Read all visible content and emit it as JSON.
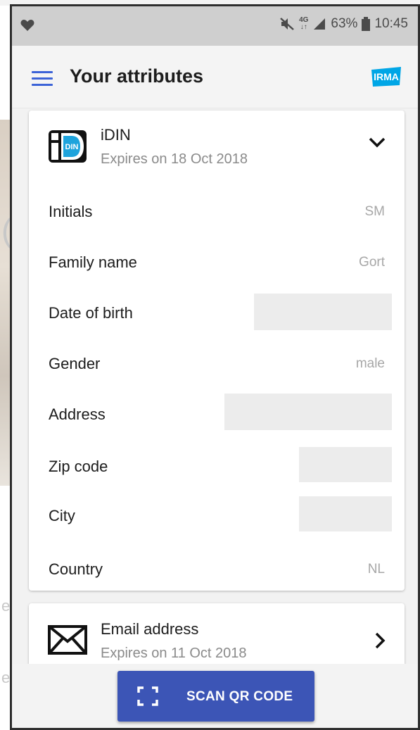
{
  "status_bar": {
    "network": "4G",
    "battery": "63%",
    "time": "10:45"
  },
  "app_bar": {
    "title": "Your attributes",
    "logo_text": "IRMA"
  },
  "credentials": [
    {
      "name": "iDIN",
      "expires": "Expires on 18 Oct 2018",
      "icon_text": "DIN",
      "expanded": true,
      "attributes": [
        {
          "label": "Initials",
          "value": "SM"
        },
        {
          "label": "Family name",
          "value": "Gort"
        },
        {
          "label": "Date of birth",
          "value": null
        },
        {
          "label": "Gender",
          "value": "male"
        },
        {
          "label": "Address",
          "value": null
        },
        {
          "label": "Zip code",
          "value": null
        },
        {
          "label": "City",
          "value": null
        },
        {
          "label": "Country",
          "value": "NL"
        }
      ]
    },
    {
      "name": "Email address",
      "expires": "Expires on 11 Oct 2018",
      "expanded": false
    }
  ],
  "scan_button": {
    "label": "SCAN QR CODE"
  },
  "colors": {
    "accent": "#3c63d7",
    "button": "#3c55b6",
    "irma_logo": "#00a6e6",
    "status_bar": "#cfcfcf"
  },
  "icons": [
    "heart-icon",
    "mute-icon",
    "signal-icon",
    "battery-icon",
    "menu-icon",
    "irma-logo",
    "idin-icon",
    "chevron-down-icon",
    "envelope-icon",
    "chevron-right-icon",
    "qr-scan-icon"
  ]
}
